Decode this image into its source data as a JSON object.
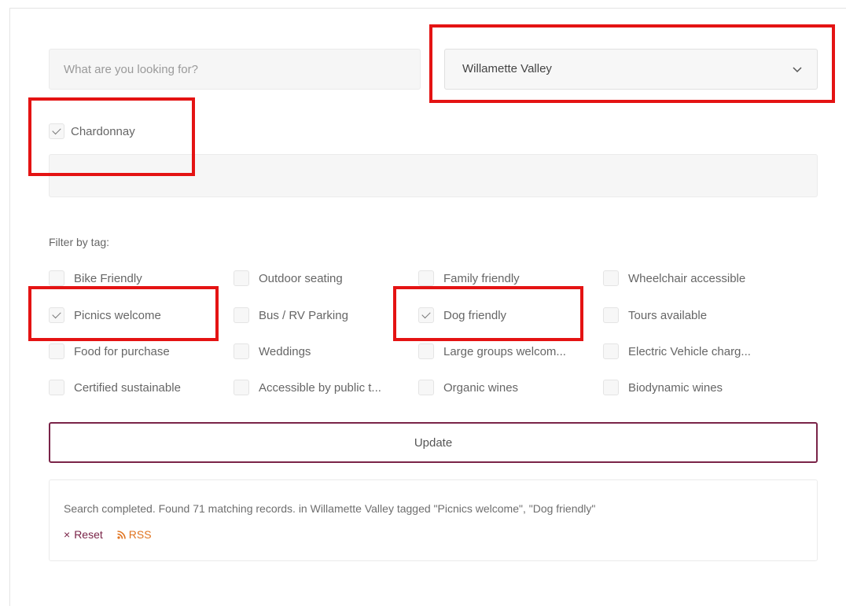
{
  "search": {
    "placeholder": "What are you looking for?"
  },
  "region_select": {
    "selected": "Willamette Valley",
    "icon": "chevron-down-icon"
  },
  "grape": {
    "label": "Chardonnay",
    "checked": true
  },
  "filter": {
    "label": "Filter by tag:",
    "tags": [
      {
        "label": "Bike Friendly",
        "checked": false
      },
      {
        "label": "Outdoor seating",
        "checked": false
      },
      {
        "label": "Family friendly",
        "checked": false
      },
      {
        "label": "Wheelchair accessible",
        "checked": false
      },
      {
        "label": "Picnics welcome",
        "checked": true
      },
      {
        "label": "Bus / RV Parking",
        "checked": false
      },
      {
        "label": "Dog friendly",
        "checked": true
      },
      {
        "label": "Tours available",
        "checked": false
      },
      {
        "label": "Food for purchase",
        "checked": false
      },
      {
        "label": "Weddings",
        "checked": false
      },
      {
        "label": "Large groups welcom...",
        "checked": false
      },
      {
        "label": "Electric Vehicle charg...",
        "checked": false
      },
      {
        "label": "Certified sustainable",
        "checked": false
      },
      {
        "label": "Accessible by public t...",
        "checked": false
      },
      {
        "label": "Organic wines",
        "checked": false
      },
      {
        "label": "Biodynamic wines",
        "checked": false
      }
    ]
  },
  "update_button": {
    "label": "Update"
  },
  "results": {
    "status": "Search completed. Found 71 matching records. in Willamette Valley tagged \"Picnics welcome\", \"Dog friendly\"",
    "reset_symbol": "×",
    "reset_label": "Reset",
    "rss_label": "RSS"
  },
  "colors": {
    "accent": "#7a2448",
    "rss": "#e0731f",
    "highlight": "#e41313"
  }
}
